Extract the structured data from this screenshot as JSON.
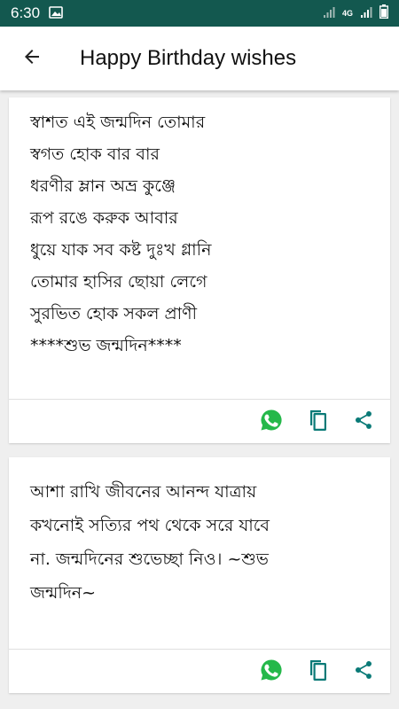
{
  "status_bar": {
    "time": "6:30",
    "network": "4G",
    "left_icons": [
      "image-notification-icon"
    ],
    "right_icons": [
      "wifi-signal-icon",
      "cell-signal-icon",
      "battery-icon"
    ]
  },
  "app_bar": {
    "title": "Happy Birthday wishes",
    "back_icon": "arrow-back-icon"
  },
  "wishes": [
    {
      "text": "স্বাশত এই জন্মদিন তোমার\nস্বগত হোক বার বার\nধরণীর ম্লান অভ্র কুঞ্জে\nরূপ রঙে করুক আবার\nধুয়ে যাক সব কষ্ট দুঃখ গ্লানি\nতোমার হাসির ছোয়া লেগে\nসুরভিত হোক সকল প্রাণী\n****শুভ জন্মদিন****"
    },
    {
      "text": "আশা রাখি জীবনের আনন্দ যাত্রায়\nকখনোই সত্যির পথ থেকে সরে যাবে\nনা. জন্মদিনের শুভেচ্ছা নিও। ~শুভ\nজন্মদিন~"
    }
  ],
  "card_actions": [
    "whatsapp-share-icon",
    "copy-icon",
    "share-icon"
  ],
  "colors": {
    "status_bar": "#13584f",
    "whatsapp": "#25b84a",
    "accent": "#0a7a77",
    "background": "#efefef",
    "card": "#ffffff"
  }
}
